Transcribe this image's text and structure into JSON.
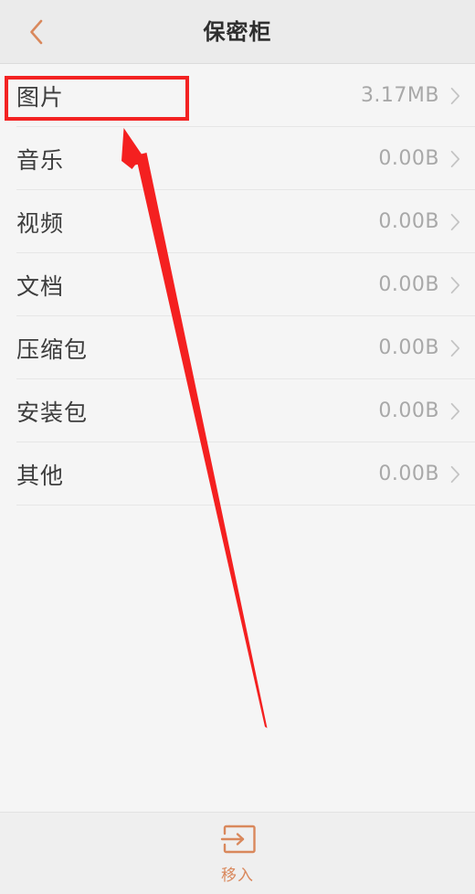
{
  "header": {
    "title": "保密柜",
    "back_icon": "chevron-left-icon",
    "accent_color": "#d9885c"
  },
  "list": {
    "rows": [
      {
        "label": "图片",
        "value": "3.17MB",
        "chevron": "chevron-right-icon"
      },
      {
        "label": "音乐",
        "value": "0.00B",
        "chevron": "chevron-right-icon"
      },
      {
        "label": "视频",
        "value": "0.00B",
        "chevron": "chevron-right-icon"
      },
      {
        "label": "文档",
        "value": "0.00B",
        "chevron": "chevron-right-icon"
      },
      {
        "label": "压缩包",
        "value": "0.00B",
        "chevron": "chevron-right-icon"
      },
      {
        "label": "安装包",
        "value": "0.00B",
        "chevron": "chevron-right-icon"
      },
      {
        "label": "其他",
        "value": "0.00B",
        "chevron": "chevron-right-icon"
      }
    ]
  },
  "bottom_bar": {
    "move_in_label": "移入",
    "move_in_icon": "move-into-box-icon",
    "accent_color": "#d9885c"
  },
  "annotation": {
    "highlight_color": "#f32222",
    "arrow_color": "#f42020",
    "target_row_label": "图片"
  }
}
